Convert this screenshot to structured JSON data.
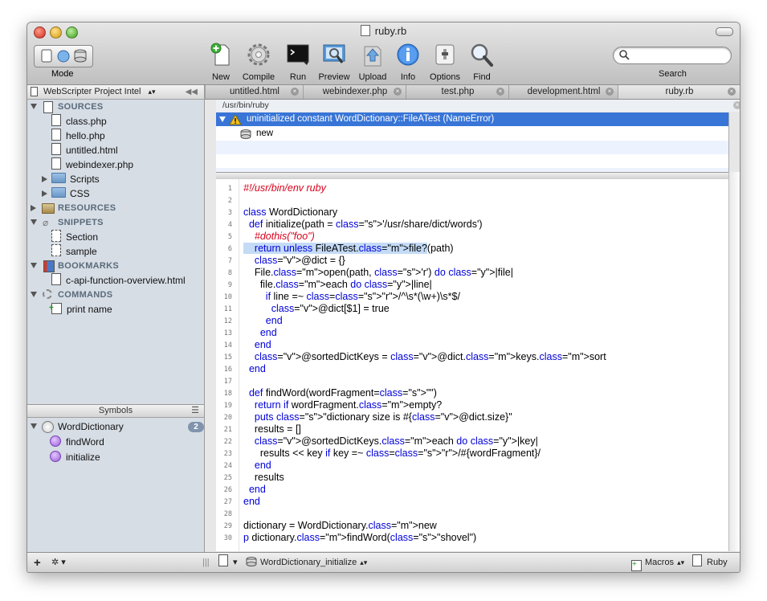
{
  "window": {
    "title": "ruby.rb"
  },
  "toolbar": {
    "mode_label": "Mode",
    "buttons": [
      {
        "label": "New",
        "icon": "new-document-icon"
      },
      {
        "label": "Compile",
        "icon": "gear-icon"
      },
      {
        "label": "Run",
        "icon": "terminal-icon"
      },
      {
        "label": "Preview",
        "icon": "preview-icon"
      },
      {
        "label": "Upload",
        "icon": "upload-icon"
      },
      {
        "label": "Info",
        "icon": "info-icon"
      },
      {
        "label": "Options",
        "icon": "options-icon"
      },
      {
        "label": "Find",
        "icon": "magnifier-icon"
      }
    ],
    "search_label": "Search",
    "search_placeholder": ""
  },
  "sidebar": {
    "project_selector": "WebScripter Project Intel",
    "sources": {
      "label": "SOURCES",
      "files": [
        "class.php",
        "hello.php",
        "untitled.html",
        "webindexer.php"
      ],
      "folders": [
        "Scripts",
        "CSS"
      ]
    },
    "resources": "RESOURCES",
    "snippets": {
      "label": "SNIPPETS",
      "items": [
        "Section",
        "sample"
      ]
    },
    "bookmarks": {
      "label": "BOOKMARKS",
      "items": [
        "c-api-function-overview.html"
      ]
    },
    "commands": {
      "label": "COMMANDS",
      "items": [
        "print name"
      ]
    }
  },
  "symbols": {
    "header": "Symbols",
    "class_name": "WordDictionary",
    "count": "2",
    "methods": [
      "findWord",
      "initialize"
    ]
  },
  "tabs": [
    {
      "label": "untitled.html",
      "active": false
    },
    {
      "label": "webindexer.php",
      "active": false
    },
    {
      "label": "test.php",
      "active": false
    },
    {
      "label": "development.html",
      "active": false
    },
    {
      "label": "ruby.rb",
      "active": true
    }
  ],
  "path_bar": "/usr/bin/ruby",
  "error": {
    "message": "uninitialized constant WordDictionary::FileATest (NameError)",
    "frame": "new"
  },
  "editor": {
    "lines": [
      "#!/usr/bin/env ruby",
      "",
      "class WordDictionary",
      "  def initialize(path = '/usr/share/dict/words')",
      "    #dothis(\"foo\")",
      "    return unless FileATest.file?(path)",
      "    @dict = {}",
      "    File.open(path, 'r') do |file|",
      "      file.each do |line|",
      "        if line =~ /^\\s*(\\w+)\\s*$/",
      "          @dict[$1] = true",
      "        end",
      "      end",
      "    end",
      "    @sortedDictKeys = @dict.keys.sort",
      "  end",
      "",
      "  def findWord(wordFragment=\"\")",
      "    return if wordFragment.empty?",
      "    puts \"dictionary size is #{@dict.size}\"",
      "    results = []",
      "    @sortedDictKeys.each do |key|",
      "      results << key if key =~ /#{wordFragment}/",
      "    end",
      "    results",
      "  end",
      "end",
      "",
      "dictionary = WordDictionary.new",
      "p dictionary.findWord(\"shovel\")"
    ]
  },
  "bottom_bar": {
    "function_popup": "WordDictionary_initialize",
    "macros_label": "Macros",
    "language_label": "Ruby"
  }
}
